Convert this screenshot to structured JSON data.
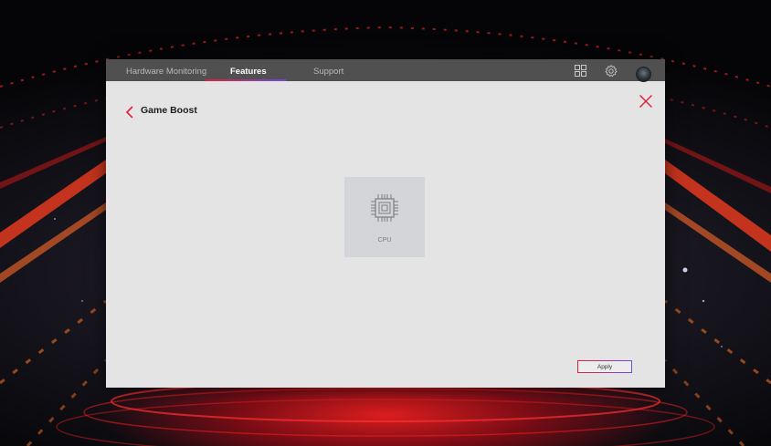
{
  "nav": {
    "tabs": [
      {
        "label": "Hardware Monitoring",
        "active": false
      },
      {
        "label": "Features",
        "active": true
      },
      {
        "label": "Support",
        "active": false
      }
    ],
    "icons": [
      "grid-icon",
      "gear-icon",
      "avatar"
    ]
  },
  "page": {
    "title": "Game Boost",
    "back_icon": "chevron-left-icon",
    "close_icon": "close-icon"
  },
  "cards": [
    {
      "label": "CPU",
      "icon": "cpu-chip-icon"
    }
  ],
  "actions": {
    "apply_label": "Apply"
  },
  "colors": {
    "accent_red": "#e0203a",
    "accent_purple": "#6a4be0",
    "topbar": "#505050",
    "panel": "#e4e4e4"
  }
}
